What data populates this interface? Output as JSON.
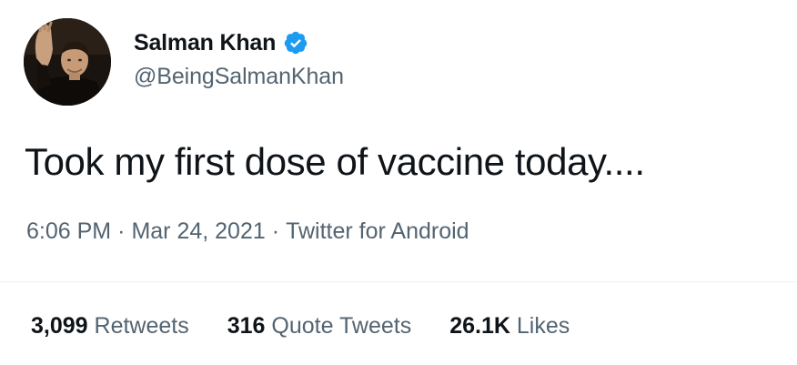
{
  "tweet": {
    "author": {
      "display_name": "Salman Khan",
      "handle": "@BeingSalmanKhan",
      "verified": true,
      "avatar_icon": "profile-photo"
    },
    "text": "Took my first dose of vaccine today....",
    "time": "6:06 PM",
    "date": "Mar 24, 2021",
    "source": "Twitter for Android",
    "separator": "·",
    "stats": {
      "retweets_count": "3,099",
      "retweets_label": "Retweets",
      "quote_tweets_count": "316",
      "quote_tweets_label": "Quote Tweets",
      "likes_count": "26.1K",
      "likes_label": "Likes"
    }
  },
  "colors": {
    "text_primary": "#0f1419",
    "text_secondary": "#536471",
    "verified_blue": "#1d9bf0",
    "divider": "#eff3f4"
  }
}
